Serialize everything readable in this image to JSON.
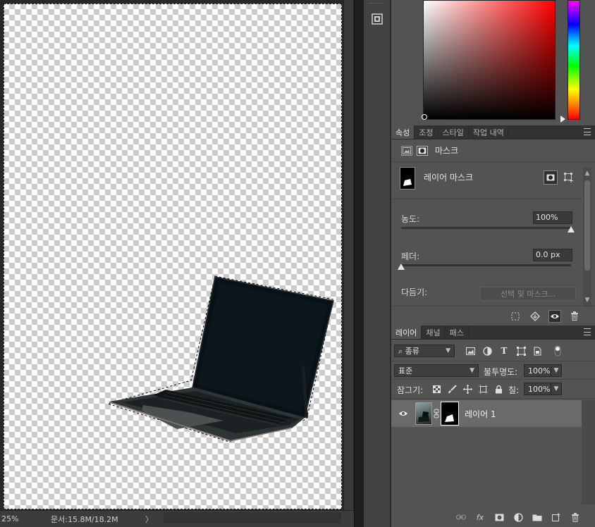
{
  "status": {
    "zoom": "25%",
    "doc_info": "문서:15.8M/18.2M",
    "arrow": "〉"
  },
  "colors": {
    "canvas_bg": "#282828",
    "panel_bg": "#535353",
    "tab_active": "#535353",
    "selection": "#6a6a6a"
  },
  "properties": {
    "tabs": [
      {
        "label": "속성",
        "active": true
      },
      {
        "label": "조정",
        "active": false
      },
      {
        "label": "스타일",
        "active": false
      },
      {
        "label": "작업 내역",
        "active": false
      }
    ],
    "header_title": "마스크",
    "mask_label": "레이어 마스크",
    "density_label": "농도:",
    "density_value": "100%",
    "density_level": 1.0,
    "feather_label": "페더:",
    "feather_value": "0.0 px",
    "feather_level": 0.0,
    "refine_label": "다듬기:",
    "refine_button": "선택 및 마스크..."
  },
  "layers": {
    "tabs": [
      {
        "label": "레이어",
        "active": true
      },
      {
        "label": "채널",
        "active": false
      },
      {
        "label": "패스",
        "active": false
      }
    ],
    "filter_kind": "종류",
    "blend_mode": "표준",
    "opacity_label": "불투명도:",
    "opacity_value": "100%",
    "lock_label": "잠그기:",
    "fill_label": "칠:",
    "fill_value": "100%",
    "layer_name": "레이어 1",
    "fx_label": "fx"
  },
  "icons": {
    "history": "history-panel-icon",
    "link": "link-icon",
    "eye": "eye-icon",
    "trash": "trash-icon"
  }
}
